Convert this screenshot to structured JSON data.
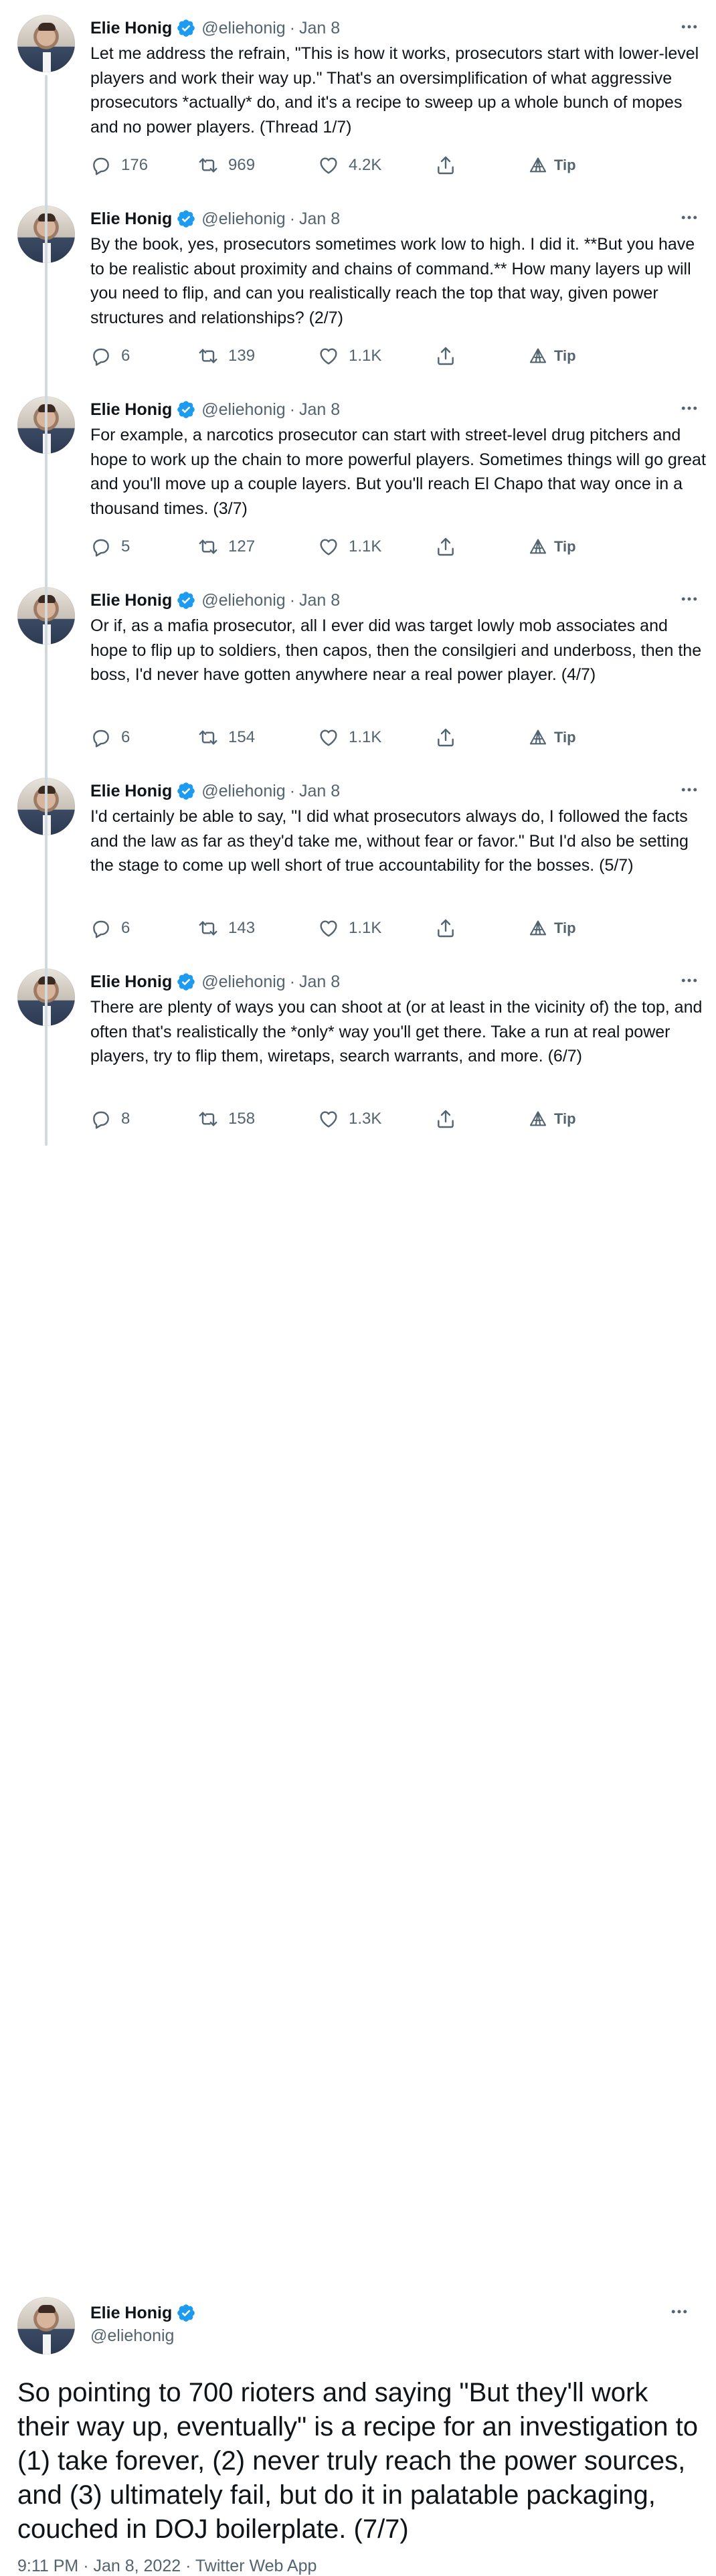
{
  "author": {
    "name": "Elie Honig",
    "handle": "@eliehonig",
    "verified_color": "#1d9bf0"
  },
  "icons": {
    "more": "more-horizontal-icon",
    "reply": "reply-icon",
    "retweet": "retweet-icon",
    "like": "heart-icon",
    "share": "share-icon",
    "tip": "tip-icon"
  },
  "tip_label": "Tip",
  "separator": "·",
  "tweets": [
    {
      "date": "Jan 8",
      "text": "Let me address the refrain, \"This is how it works, prosecutors start with lower-level players and work their way up.\" That's an oversimplification of what aggressive prosecutors *actually* do, and it's a recipe to sweep up a whole bunch of mopes and no power players. (Thread 1/7)",
      "replies": "176",
      "retweets": "969",
      "likes": "4.2K"
    },
    {
      "date": "Jan 8",
      "text": "By the book, yes, prosecutors sometimes work low to high. I did it. **But you have to be realistic about proximity and chains of command.** How many layers up will you need to flip, and can you realistically reach the top that way, given power structures and relationships? (2/7)",
      "replies": "6",
      "retweets": "139",
      "likes": "1.1K"
    },
    {
      "date": "Jan 8",
      "text": "For example, a narcotics prosecutor can start with street-level drug pitchers and hope to work up the chain to more powerful players. Sometimes things will go great and you'll move up a couple layers. But you'll reach El Chapo that way once in a thousand times. (3/7)",
      "replies": "5",
      "retweets": "127",
      "likes": "1.1K"
    },
    {
      "date": "Jan 8",
      "text": "Or if, as a mafia prosecutor, all I ever did was target lowly mob associates and hope to flip up to soldiers, then capos, then the consilgieri and underboss, then the boss, I'd never have gotten anywhere near a real power player. (4/7)",
      "replies": "6",
      "retweets": "154",
      "likes": "1.1K"
    },
    {
      "date": "Jan 8",
      "text": "I'd certainly be able to say, \"I did what prosecutors always do, I followed the facts and the law as far as they'd take me, without fear or favor.\" But I'd also be setting the stage to come up well short of true accountability for the bosses. (5/7)",
      "replies": "6",
      "retweets": "143",
      "likes": "1.1K"
    },
    {
      "date": "Jan 8",
      "text": "There are plenty of ways you can shoot at (or at least in the vicinity of) the top, and often that's realistically the *only* way you'll get there. Take a run at real power players, try to flip them, wiretaps, search warrants, and more. (6/7)",
      "replies": "8",
      "retweets": "158",
      "likes": "1.3K"
    }
  ],
  "main_tweet": {
    "text": "So pointing to 700 rioters and saying \"But they'll work their way up, eventually\" is a recipe for an investigation to (1) take forever, (2) never truly reach the power sources, and (3) ultimately fail, but do it in palatable packaging, couched in DOJ boilerplate. (7/7)",
    "meta": "9:11 PM · Jan 8, 2022 · Twitter Web App"
  }
}
